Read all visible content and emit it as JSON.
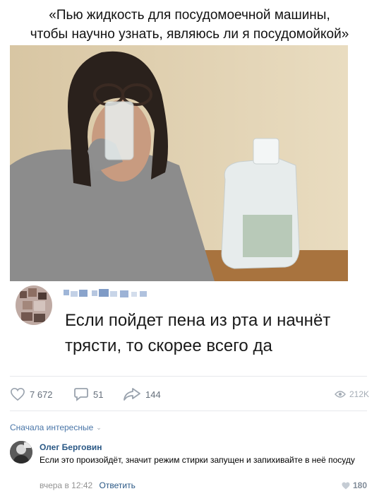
{
  "post": {
    "caption_line1": "«Пью жидкость для посудомоечной машины,",
    "caption_line2": "чтобы научно узнать, являюсь ли я посудомойкой»",
    "comment_text": "Если пойдет пена из рта и начнёт трясти, то скорее всего да"
  },
  "actions": {
    "likes": "7 672",
    "comments": "51",
    "shares": "144",
    "views": "212K"
  },
  "comments_section": {
    "sort_label": "Сначала интересные",
    "items": [
      {
        "author": "Олег Берговин",
        "text": "Если это произойдёт, значит режим стирки запущен и запихивайте в неё посуду",
        "time": "вчера в 12:42",
        "reply_label": "Ответить",
        "likes": "180"
      }
    ]
  },
  "colors": {
    "link": "#2a5885",
    "accent": "#4a76a8",
    "icon": "#99a2ad"
  }
}
